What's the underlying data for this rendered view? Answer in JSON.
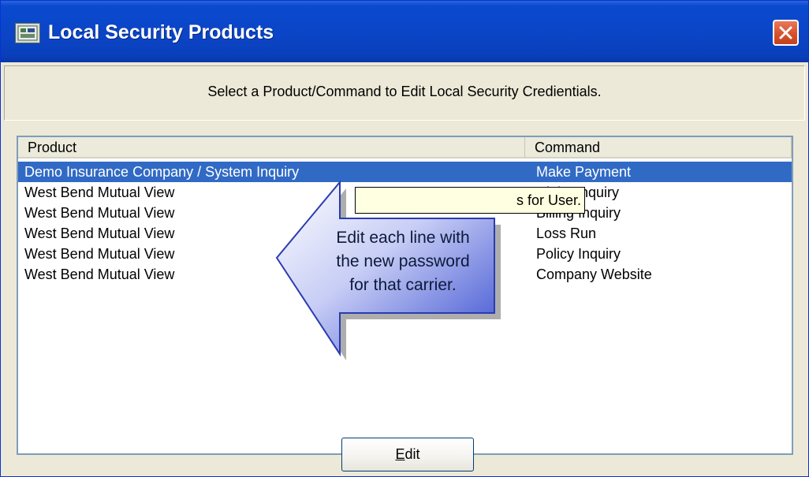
{
  "window": {
    "title": "Local Security Products",
    "icon": "app-icon",
    "close_icon": "close-icon"
  },
  "header": {
    "message": "Select a Product/Command to Edit Local Security Credientials."
  },
  "list": {
    "columns": [
      "Product",
      "Command"
    ],
    "rows": [
      {
        "product": "Demo Insurance Company / System Inquiry",
        "command": "Make Payment",
        "selected": true
      },
      {
        "product": "West Bend Mutual View",
        "command": "Claim Inquiry"
      },
      {
        "product": "West Bend Mutual View",
        "command": "Billing Inquiry"
      },
      {
        "product": "West Bend Mutual View",
        "command": "Loss Run"
      },
      {
        "product": "West Bend Mutual View",
        "command": "Policy Inquiry"
      },
      {
        "product": "West Bend Mutual View",
        "command": "Company Website"
      }
    ]
  },
  "tooltip": {
    "text": "s for User."
  },
  "callout": {
    "line1": "Edit each line with",
    "line2": "the new password",
    "line3": "for that carrier."
  },
  "buttons": {
    "edit_mnemonic": "E",
    "edit_rest": "dit"
  },
  "colors": {
    "titlebar": "#0b45c7",
    "selection": "#316ac5",
    "arrow": "#3a4fd0"
  }
}
